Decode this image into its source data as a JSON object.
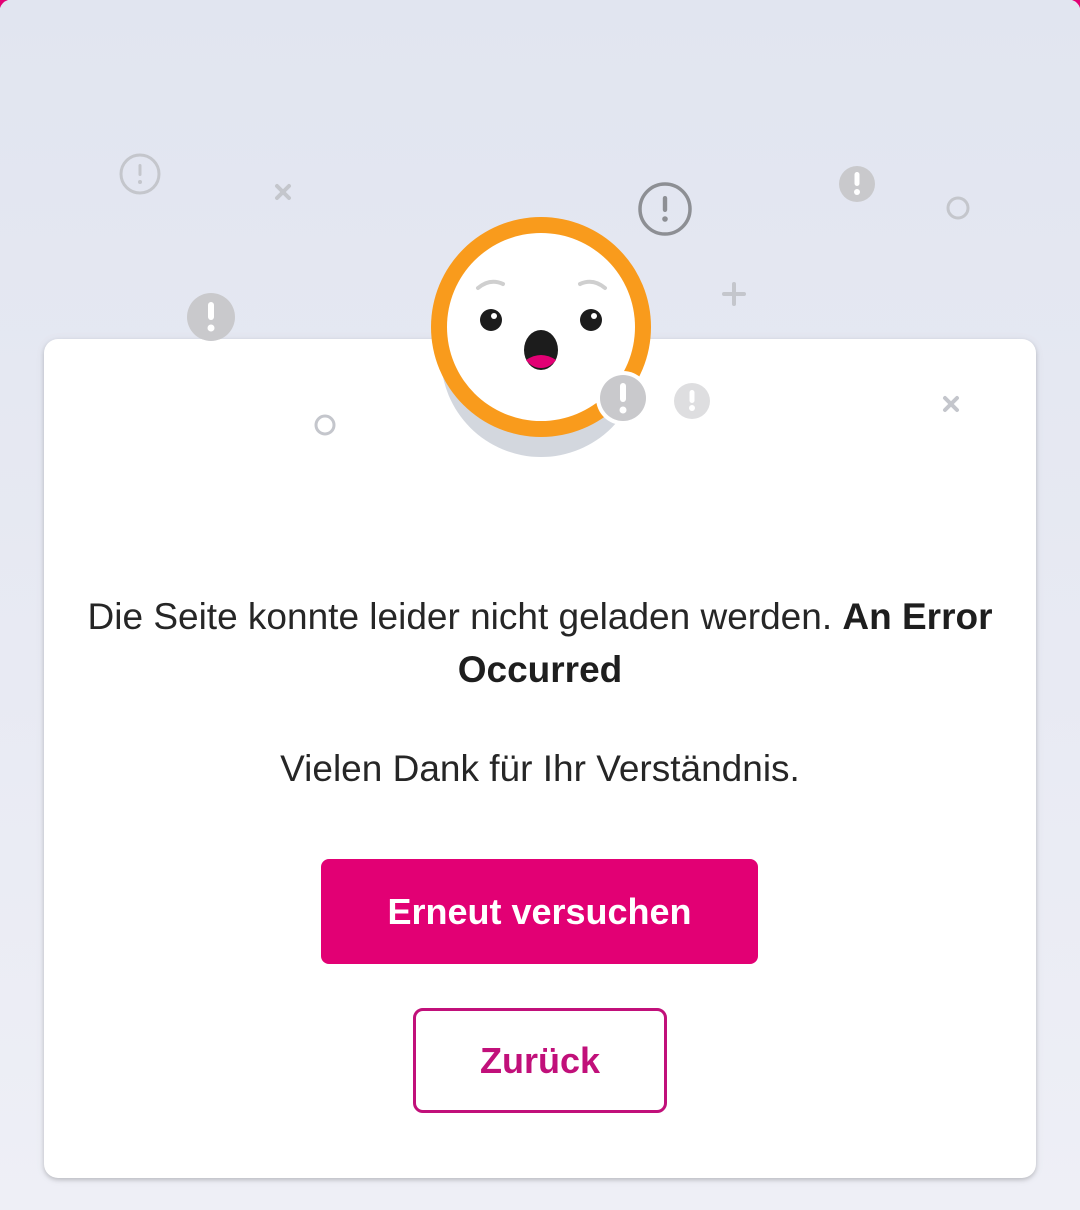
{
  "error": {
    "message": "Die Seite konnte leider nicht geladen werden.",
    "error_title": "An Error Occurred",
    "thanks": "Vielen Dank für Ihr Verständnis."
  },
  "actions": {
    "retry_label": "Erneut versuchen",
    "back_label": "Zurück"
  },
  "colors": {
    "brand": "#e20074",
    "back_border": "#c1107a",
    "face_ring": "#f99b1c",
    "badge_gray": "#c9c9c9"
  },
  "illustration": {
    "character": "surprised-face-icon",
    "decorations": [
      "exclamation-circle-icon",
      "exclamation-badge-icon",
      "small-x-icon",
      "small-circle-icon",
      "plus-icon"
    ]
  }
}
